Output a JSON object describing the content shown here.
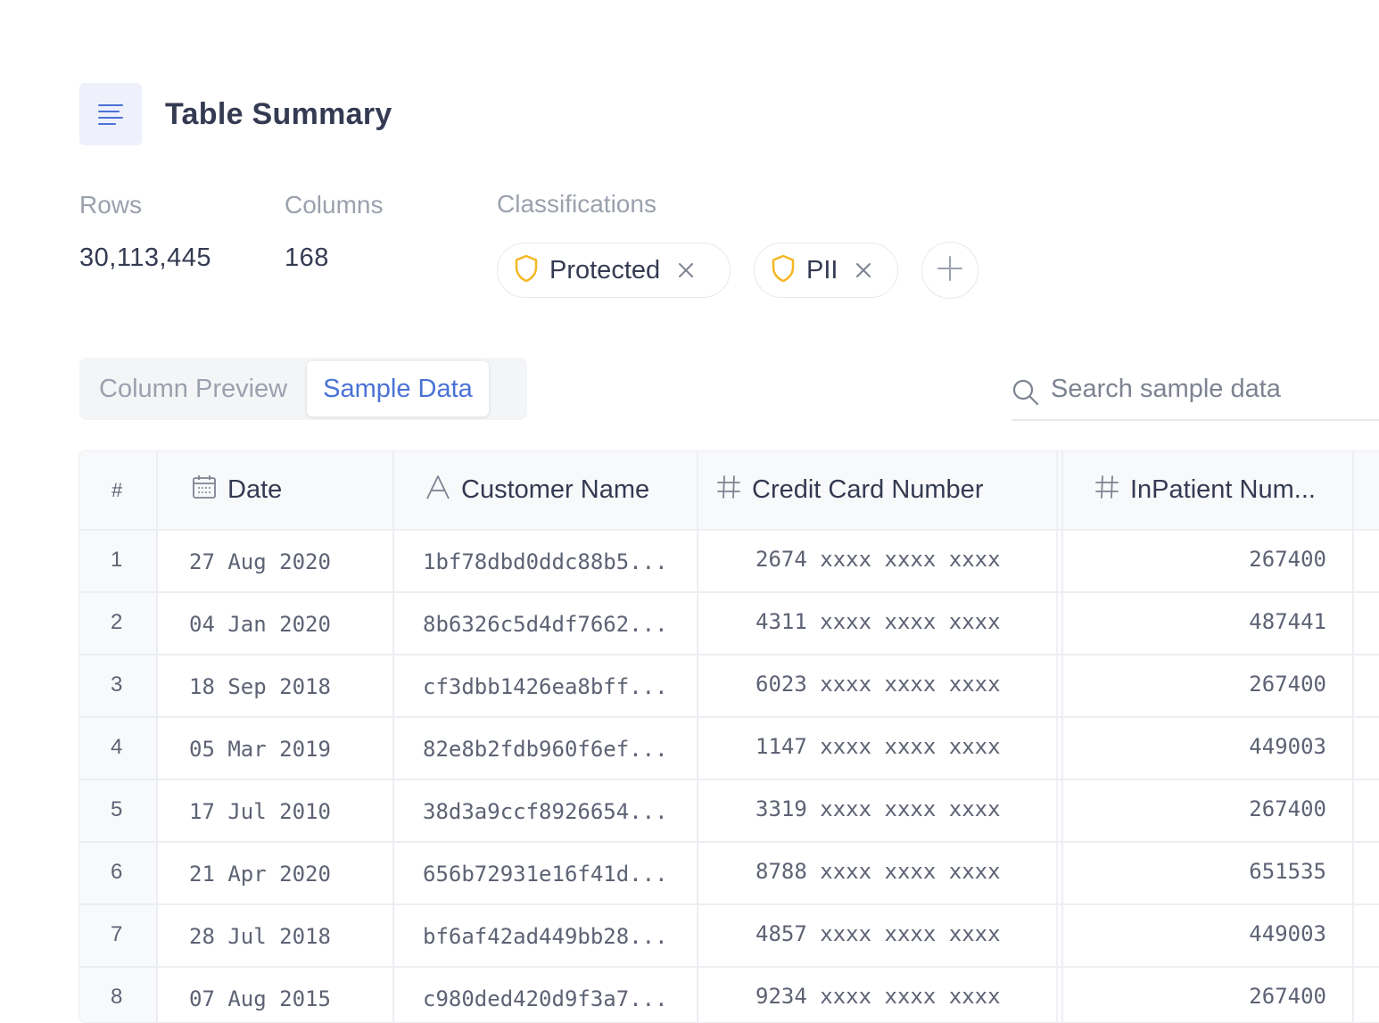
{
  "header": {
    "title": "Table Summary",
    "icon": "text-lines-icon"
  },
  "stats": {
    "rows_label": "Rows",
    "rows_value": "30,113,445",
    "columns_label": "Columns",
    "columns_value": "168"
  },
  "classifications": {
    "label": "Classifications",
    "chips": [
      {
        "label": "Protected",
        "icon": "shield-icon",
        "icon_color": "#f5b723"
      },
      {
        "label": "PII",
        "icon": "shield-icon",
        "icon_color": "#f5b723"
      }
    ]
  },
  "tabs": [
    {
      "label": "Column Preview",
      "active": false
    },
    {
      "label": "Sample Data",
      "active": true
    }
  ],
  "search": {
    "placeholder": "Search sample data",
    "value": ""
  },
  "colors": {
    "accent": "#4a72d6",
    "warning": "#f5b723"
  },
  "table": {
    "columns": [
      {
        "label": "#",
        "icon": ""
      },
      {
        "label": "Date",
        "icon": "calendar-icon"
      },
      {
        "label": "Customer Name",
        "icon": "text-type-icon"
      },
      {
        "label": "Credit Card Number",
        "icon": "hash-icon"
      },
      {
        "label": "InPatient Num...",
        "icon": "hash-icon"
      }
    ],
    "rows": [
      {
        "n": "1",
        "date": "27 Aug 2020",
        "name": "1bf78dbd0ddc88b5...",
        "card": "2674 xxxx xxxx xxxx",
        "inpatient": "267400"
      },
      {
        "n": "2",
        "date": "04 Jan 2020",
        "name": "8b6326c5d4df7662...",
        "card": "4311 xxxx xxxx xxxx",
        "inpatient": "487441"
      },
      {
        "n": "3",
        "date": "18 Sep 2018",
        "name": "cf3dbb1426ea8bff...",
        "card": "6023 xxxx xxxx xxxx",
        "inpatient": "267400"
      },
      {
        "n": "4",
        "date": "05 Mar 2019",
        "name": "82e8b2fdb960f6ef...",
        "card": "1147 xxxx xxxx xxxx",
        "inpatient": "449003"
      },
      {
        "n": "5",
        "date": "17 Jul 2010",
        "name": "38d3a9ccf8926654...",
        "card": "3319 xxxx xxxx xxxx",
        "inpatient": "267400"
      },
      {
        "n": "6",
        "date": "21 Apr 2020",
        "name": "656b72931e16f41d...",
        "card": "8788 xxxx xxxx xxxx",
        "inpatient": "651535"
      },
      {
        "n": "7",
        "date": "28 Jul 2018",
        "name": "bf6af42ad449bb28...",
        "card": "4857 xxxx xxxx xxxx",
        "inpatient": "449003"
      },
      {
        "n": "8",
        "date": "07 Aug 2015",
        "name": "c980ded420d9f3a7...",
        "card": "9234 xxxx xxxx xxxx",
        "inpatient": "267400"
      }
    ]
  }
}
